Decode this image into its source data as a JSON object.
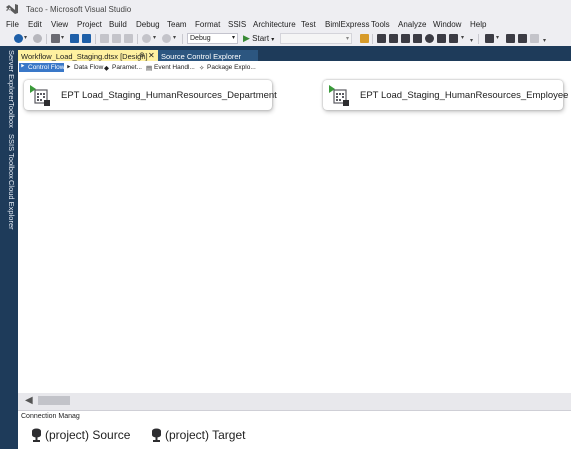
{
  "window": {
    "title": "Taco - Microsoft Visual Studio"
  },
  "menu": {
    "items": [
      "File",
      "Edit",
      "View",
      "Project",
      "Build",
      "Debug",
      "Team",
      "Format",
      "SSIS",
      "Architecture",
      "Test",
      "BimlExpress",
      "Tools",
      "Analyze",
      "Window",
      "Help"
    ]
  },
  "toolbar": {
    "configuration": "Debug",
    "start_label": "Start",
    "platform": ""
  },
  "side_panels": [
    "Server Explorer",
    "Toolbox",
    "SSIS Toolbox",
    "Cloud Explorer"
  ],
  "document_tabs": {
    "active": "Workflow_Load_Staging.dtsx [Design]",
    "pin_glyph": "⊕",
    "close_glyph": "✕",
    "other": "Source Control Explorer"
  },
  "designer_tabs": [
    "Control Flow",
    "Data Flow",
    "Paramet...",
    "Event Handl...",
    "Package Explo..."
  ],
  "tasks": [
    {
      "label": "EPT Load_Staging_HumanResources_Department"
    },
    {
      "label": "EPT Load_Staging_HumanResources_Employee"
    }
  ],
  "connection_manager": {
    "header": "Connection Manag",
    "connections": [
      {
        "label": "(project) Source"
      },
      {
        "label": "(project) Target"
      }
    ]
  },
  "colors": {
    "frame_dark": "#1e3b5a",
    "active_tab": "#fff1a0",
    "selected_designer_tab": "#3a78c8",
    "play_green": "#388a34"
  },
  "icons": {
    "vs_logo": "visual-studio-logo-icon",
    "start": "play-icon",
    "task": "execute-package-task-icon",
    "connection": "connection-manager-icon"
  }
}
